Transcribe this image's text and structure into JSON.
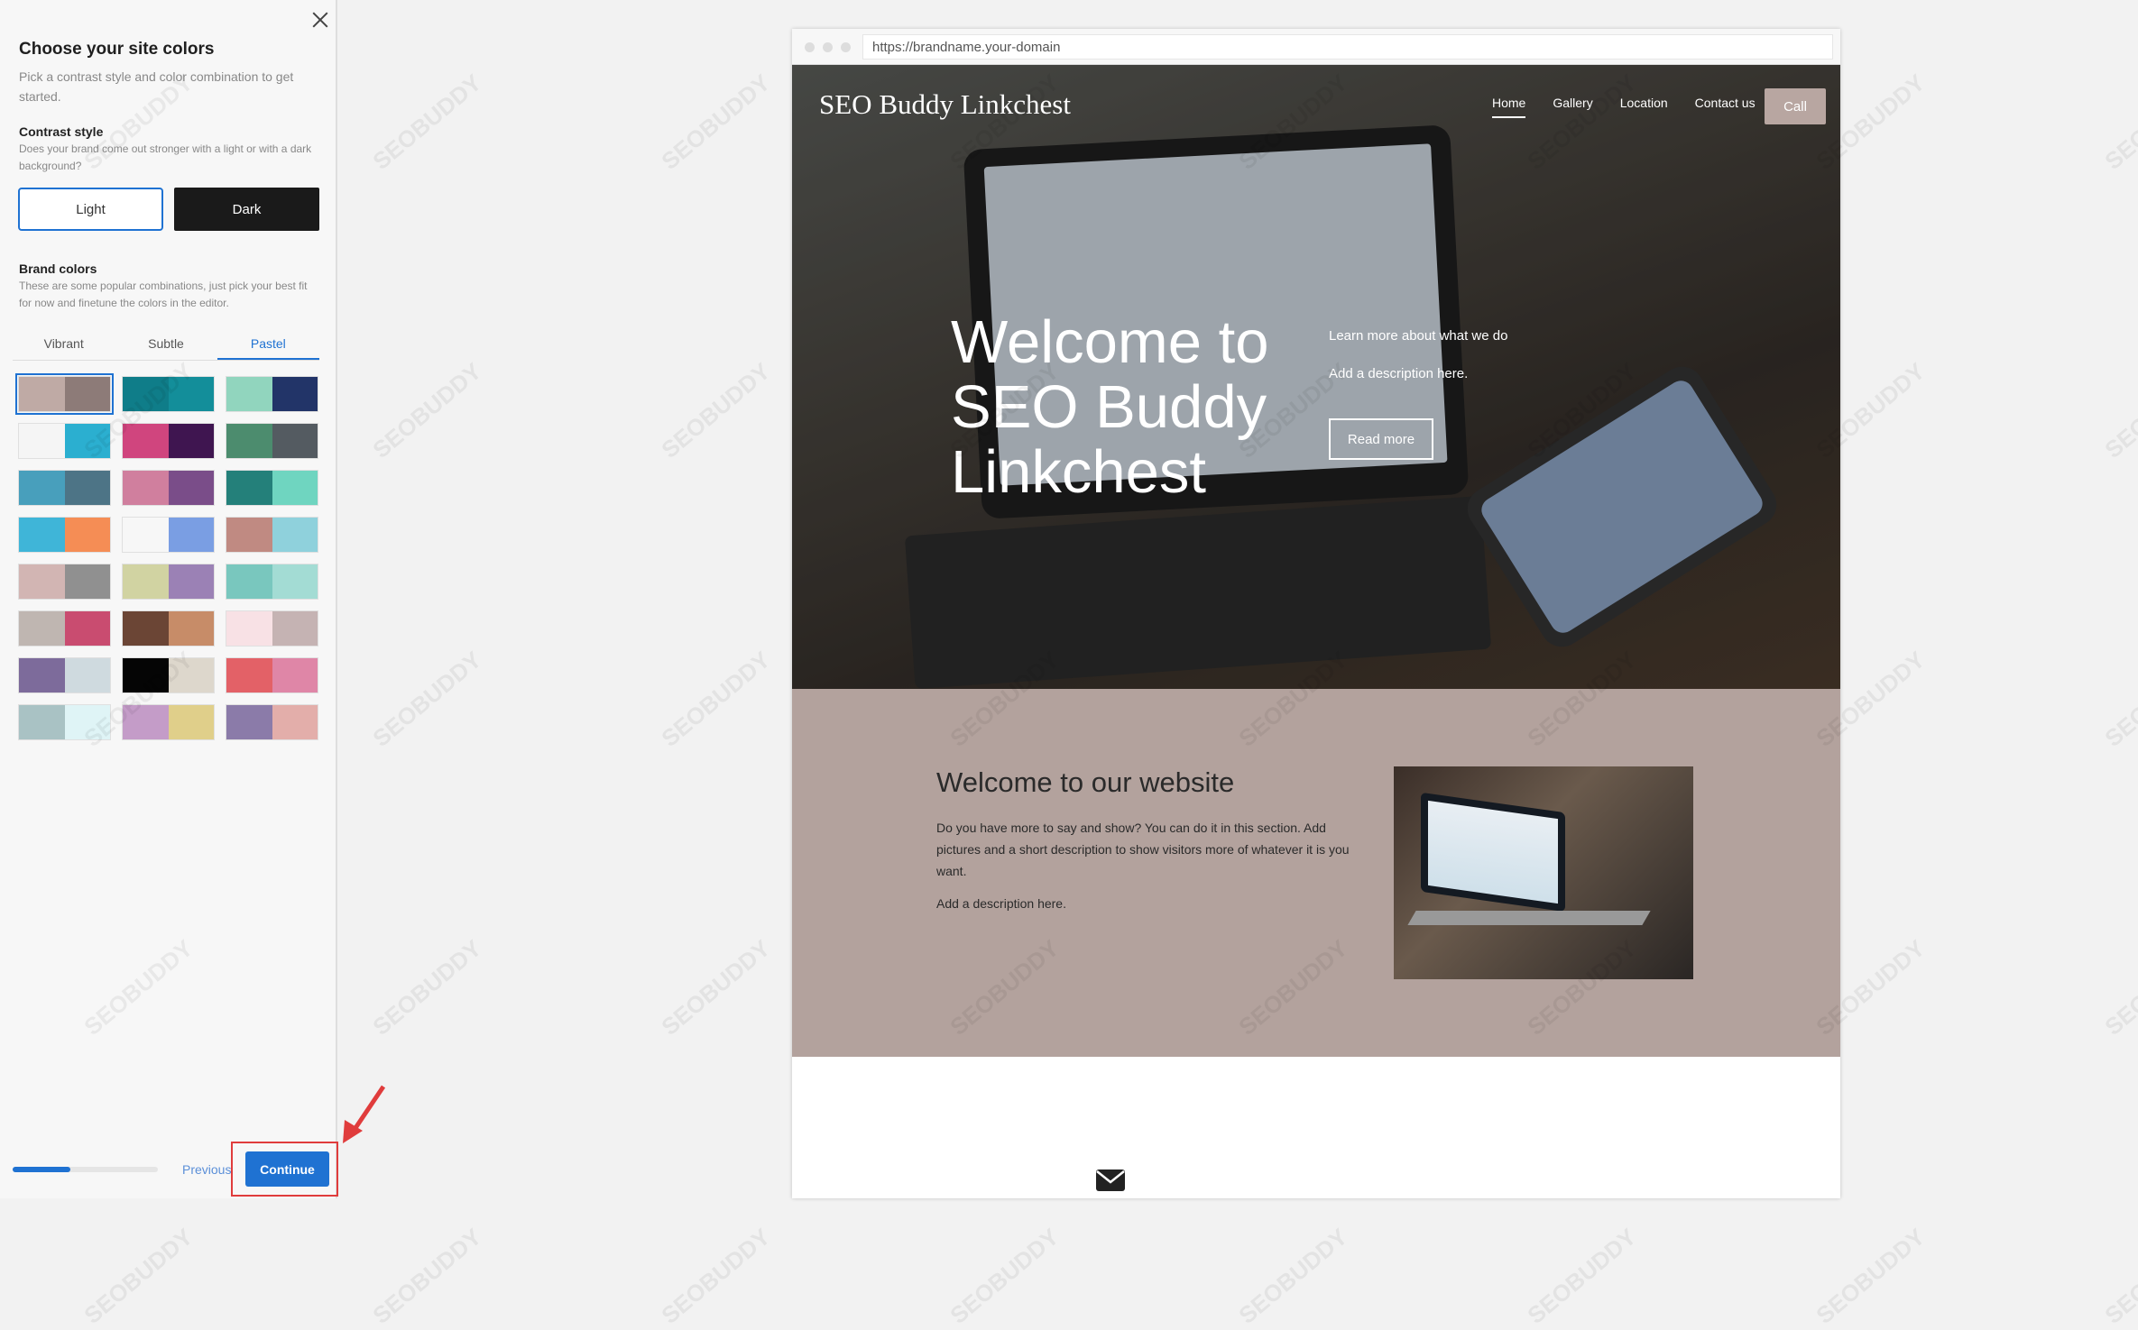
{
  "panel": {
    "title": "Choose your site colors",
    "subtitle": "Pick a contrast style and color combination to get started.",
    "contrast": {
      "heading": "Contrast style",
      "desc": "Does your brand come out stronger with a light or with a dark background?",
      "light_label": "Light",
      "dark_label": "Dark"
    },
    "brand": {
      "heading": "Brand colors",
      "desc": "These are some popular combinations, just pick your best fit for now and finetune the colors in the editor.",
      "tabs": [
        "Vibrant",
        "Subtle",
        "Pastel"
      ],
      "active_tab": "Pastel",
      "selected_swatch": 0,
      "swatches": [
        [
          "#bfaaa5",
          "#8d7b78"
        ],
        [
          "#0f7d89",
          "#138e9a"
        ],
        [
          "#91d5be",
          "#223468"
        ],
        [
          "#f5f5f5",
          "#2bafd0"
        ],
        [
          "#d0457e",
          "#3f1550"
        ],
        [
          "#4c8c6e",
          "#545b61"
        ],
        [
          "#489fbc",
          "#4d7486"
        ],
        [
          "#d07f9e",
          "#7a4d89"
        ],
        [
          "#24807a",
          "#6fd5c0"
        ],
        [
          "#3fb5d8",
          "#f58d55"
        ],
        [
          "#f7f7f7",
          "#7a9ee3"
        ],
        [
          "#c08a82",
          "#8fd1dc"
        ],
        [
          "#d2b5b3",
          "#909090"
        ],
        [
          "#d1d3a2",
          "#9b81b5"
        ],
        [
          "#79c7be",
          "#a3dcd4"
        ],
        [
          "#bfb6b1",
          "#c94c70"
        ],
        [
          "#6b4535",
          "#c78c68"
        ],
        [
          "#f8e1e5",
          "#c5b3b3"
        ],
        [
          "#7d6b9b",
          "#cfdadf"
        ],
        [
          "#050505",
          "#ddd7cc"
        ],
        [
          "#e36167",
          "#df86a7"
        ],
        [
          "#a9c2c4",
          "#dff4f6"
        ],
        [
          "#c49cc8",
          "#e0cf8a"
        ],
        [
          "#8b7ba9",
          "#e3aeaa"
        ]
      ]
    },
    "footer": {
      "progress": 0.4,
      "previous_label": "Previous",
      "continue_label": "Continue"
    }
  },
  "preview": {
    "url": "https://brandname.your-domain",
    "site_title": "SEO Buddy Linkchest",
    "nav": [
      "Home",
      "Gallery",
      "Location",
      "Contact us"
    ],
    "nav_active": "Home",
    "call_label": "Call",
    "hero_heading": "Welcome to SEO Buddy Linkchest",
    "hero_learn": "Learn more about what we do",
    "hero_desc": "Add a description here.",
    "hero_button": "Read more",
    "section_title": "Welcome to our website",
    "section_body": "Do you have more to say and show? You can do it in this section. Add pictures and a short description to show visitors more of whatever it is you want.",
    "section_desc": "Add a description here."
  },
  "watermark": "SEOBUDDY"
}
